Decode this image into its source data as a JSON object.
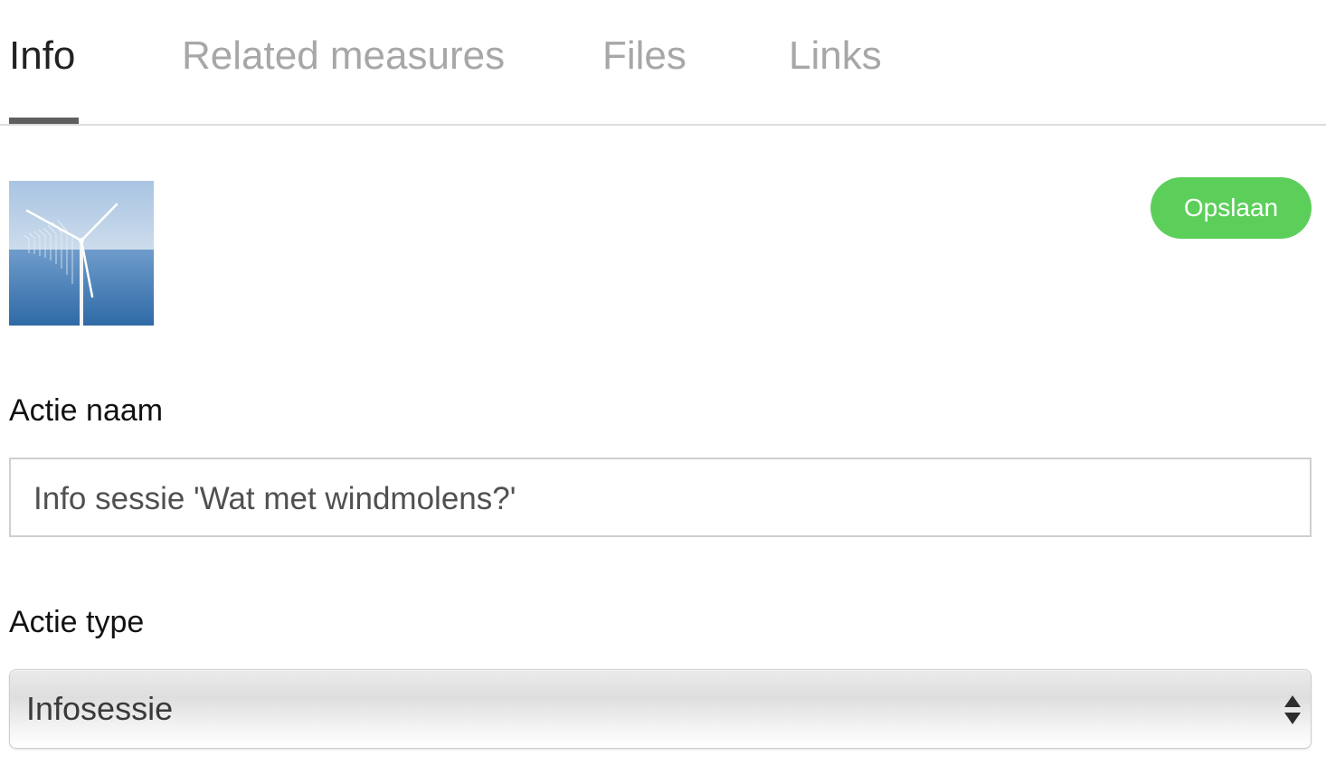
{
  "tabs": [
    {
      "label": "Info",
      "active": true
    },
    {
      "label": "Related measures",
      "active": false
    },
    {
      "label": "Files",
      "active": false
    },
    {
      "label": "Links",
      "active": false
    }
  ],
  "thumbnail": {
    "icon": "wind-turbine-photo"
  },
  "toolbar": {
    "save_label": "Opslaan"
  },
  "form": {
    "name_label": "Actie naam",
    "name_value": "Info sessie 'Wat met windmolens?'",
    "type_label": "Actie type",
    "type_value": "Infosessie"
  },
  "colors": {
    "save_button": "#5ccf5a",
    "active_tab_indicator": "#5f5f5f",
    "inactive_tab_text": "#a7a7a7"
  }
}
